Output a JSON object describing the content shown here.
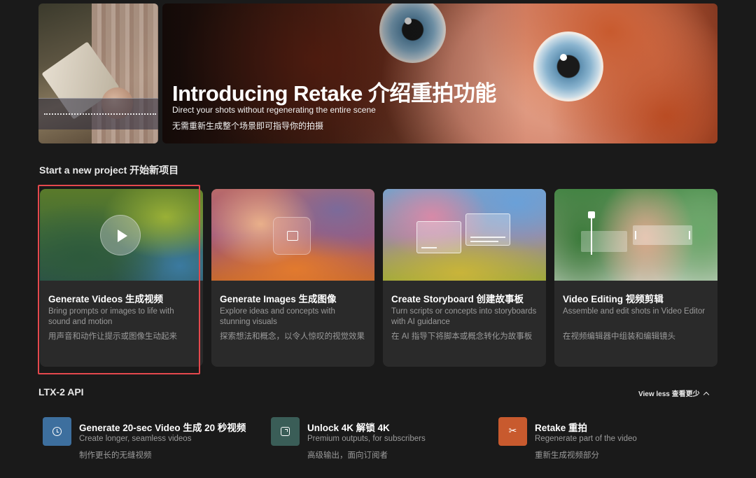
{
  "hero": {
    "title": "Introducing Retake 介绍重拍功能",
    "subtitle": "Direct your shots without regenerating the entire scene",
    "subtitle_cn": "无需重新生成整个场景即可指导你的拍摄"
  },
  "new_project": {
    "heading": "Start a new project 开始新项目",
    "cards": [
      {
        "title": "Generate Videos 生成视频",
        "description": "Bring prompts or images to life with sound and motion",
        "description_cn": "用声音和动作让提示或图像生动起来",
        "icon": "play-icon",
        "highlighted": true
      },
      {
        "title": "Generate Images 生成图像",
        "description": "Explore ideas and concepts with stunning visuals",
        "description_cn": "探索想法和概念，以令人惊叹的视觉效果",
        "icon": "image-sparkle-icon"
      },
      {
        "title": "Create Storyboard 创建故事板",
        "description": "Turn scripts or concepts into storyboards with AI guidance",
        "description_cn": "在 AI 指导下将脚本或概念转化为故事板",
        "icon": "storyboard-frames-icon"
      },
      {
        "title": "Video Editing 视频剪辑",
        "description": "Assemble and edit shots in Video Editor",
        "description_cn": "在视频编辑器中组装和编辑镜头",
        "icon": "timeline-icon"
      }
    ]
  },
  "api": {
    "heading": "LTX-2 API",
    "toggle_label": "View less 查看更少",
    "toggle_icon": "chevron-up-icon",
    "items": [
      {
        "title": "Generate 20-sec Video 生成 20 秒视频",
        "description": "Create longer, seamless videos",
        "description_cn": "制作更长的无缝视频",
        "icon": "clock-icon",
        "color": "#3d6f9e"
      },
      {
        "title": "Unlock 4K 解锁 4K",
        "description": "Premium outputs, for subscribers",
        "description_cn": "高级输出，面向订阅者",
        "icon": "expand-icon",
        "color": "#3a5d57"
      },
      {
        "title": "Retake 重拍",
        "description": "Regenerate part of the video",
        "description_cn": "重新生成视频部分",
        "icon": "scissors-icon",
        "color": "#c85a2e"
      }
    ]
  },
  "colors": {
    "background": "#1a1a1a",
    "card_background": "#2a2a2a",
    "highlight_border": "#e5484d"
  }
}
